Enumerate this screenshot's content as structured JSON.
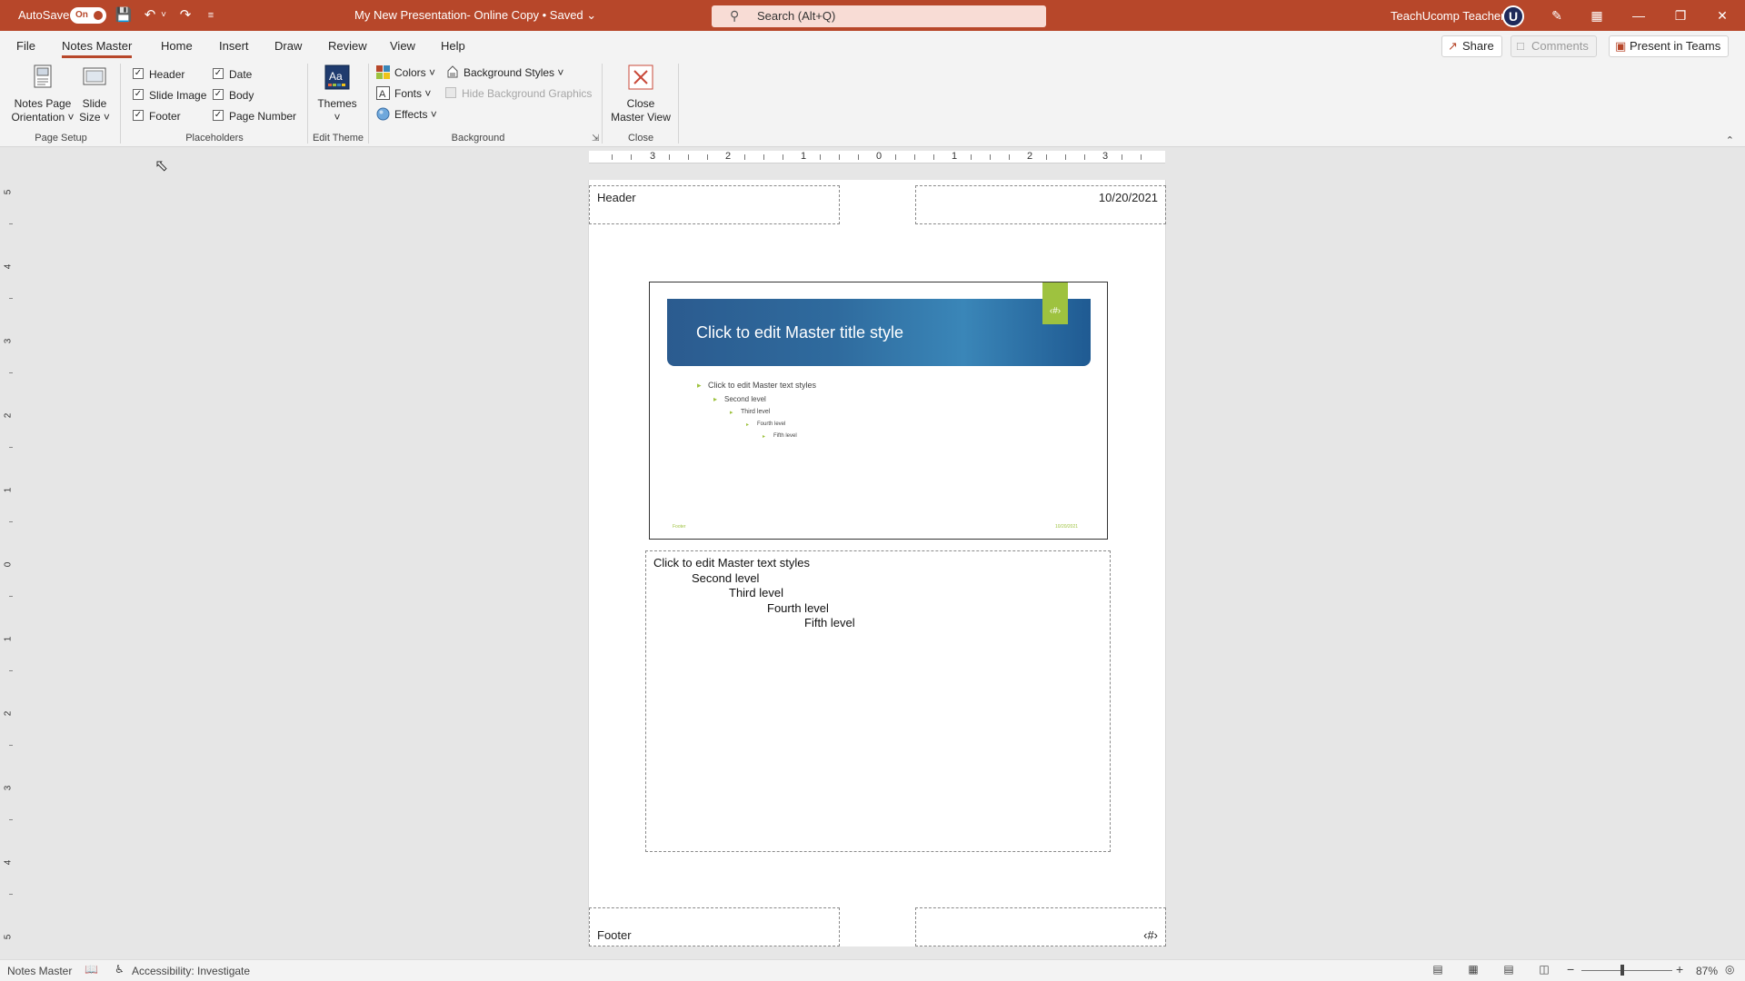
{
  "titlebar": {
    "autosave_label": "AutoSave",
    "autosave_state": "On",
    "doc_title": "My New Presentation- Online Copy • Saved ⌄",
    "search_placeholder": "Search (Alt+Q)",
    "user_name": "TeachUcomp Teacher",
    "avatar_letter": "U"
  },
  "tabs": [
    "File",
    "Notes Master",
    "Home",
    "Insert",
    "Draw",
    "Review",
    "View",
    "Help"
  ],
  "active_tab": "Notes Master",
  "right_buttons": {
    "share": "Share",
    "comments": "Comments",
    "present": "Present in Teams"
  },
  "ribbon": {
    "page_setup": {
      "label": "Page Setup",
      "notes_page_orientation": "Notes Page Orientation ˅",
      "notes_page_line1": "Notes Page",
      "notes_page_line2": "Orientation ˅",
      "slide_size_line1": "Slide",
      "slide_size_line2": "Size ˅"
    },
    "placeholders": {
      "label": "Placeholders",
      "header": "Header",
      "slide_image": "Slide Image",
      "footer": "Footer",
      "date": "Date",
      "body": "Body",
      "page_number": "Page Number"
    },
    "edit_theme": {
      "label": "Edit Theme",
      "themes": "Themes",
      "themes_arrow": "˅"
    },
    "background": {
      "label": "Background",
      "colors": "Colors ˅",
      "fonts": "Fonts ˅",
      "effects": "Effects ˅",
      "background_styles": "Background Styles ˅",
      "hide_background_graphics": "Hide Background Graphics"
    },
    "close": {
      "label": "Close",
      "close_line1": "Close",
      "close_line2": "Master View"
    }
  },
  "ruler": {
    "h_numbers": [
      "3",
      "2",
      "1",
      "0",
      "1",
      "2",
      "3"
    ],
    "v_numbers": [
      "5",
      "4",
      "3",
      "2",
      "1",
      "0",
      "1",
      "2",
      "3",
      "4",
      "5"
    ]
  },
  "page": {
    "header": "Header",
    "date": "10/20/2021",
    "footer": "Footer",
    "page_number": "‹#›",
    "slide": {
      "title": "Click to edit Master title style",
      "number_tag": "‹#›",
      "levels": [
        "Click to edit Master text styles",
        "Second level",
        "Third level",
        "Fourth level",
        "Fifth level"
      ],
      "footer_left": "Footer",
      "footer_right": "10/20/2021"
    },
    "body_levels": [
      "Click to edit Master text styles",
      "Second level",
      "Third level",
      "Fourth level",
      "Fifth level"
    ]
  },
  "statusbar": {
    "view_name": "Notes Master",
    "accessibility": "Accessibility: Investigate",
    "zoom": "87%"
  },
  "colors": {
    "accent": "#b7472a",
    "slide_banner": "#2f6b9e",
    "slide_accent": "#9ec23f"
  }
}
